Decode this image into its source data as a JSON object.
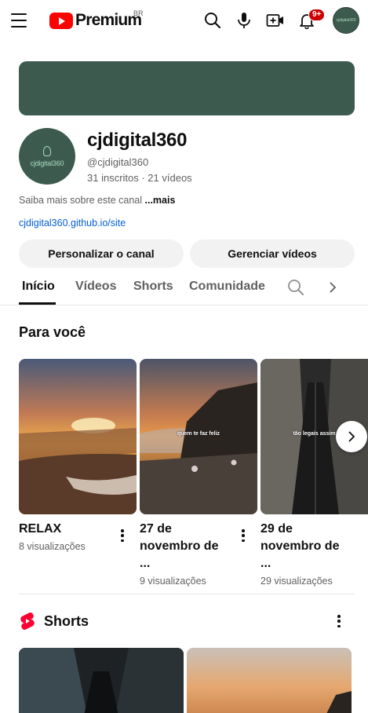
{
  "header": {
    "brand": "Premium",
    "country_code": "BR",
    "notification_badge": "9+",
    "avatar_text": "cjdigital360"
  },
  "channel": {
    "avatar_text": "cjdigital360",
    "name": "cjdigital360",
    "handle": "@cjdigital360",
    "stats": "31 inscritos · 21 vídeos",
    "about_text": "Saiba mais sobre este canal ",
    "about_more": "...mais",
    "link": "cjdigital360.github.io/site",
    "customize_button": "Personalizar o canal",
    "manage_button": "Gerenciar vídeos"
  },
  "tabs": [
    {
      "label": "Início",
      "active": true
    },
    {
      "label": "Vídeos",
      "active": false
    },
    {
      "label": "Shorts",
      "active": false
    },
    {
      "label": "Comunidade",
      "active": false
    }
  ],
  "for_you": {
    "title": "Para você",
    "videos": [
      {
        "title": "RELAX",
        "views": "8 visualizações",
        "caption": ""
      },
      {
        "title": "27 de novembro de ...",
        "views": "9 visualizações",
        "caption": "quem te faz feliz"
      },
      {
        "title": "29 de novembro de ...",
        "views": "29 visualizações",
        "caption": "tão legais assim"
      }
    ]
  },
  "shorts": {
    "title": "Shorts"
  },
  "colors": {
    "brand_red": "#ff0000",
    "channel_green": "#3d5a4f",
    "link_blue": "#065fd4",
    "badge_red": "#cc0000"
  }
}
